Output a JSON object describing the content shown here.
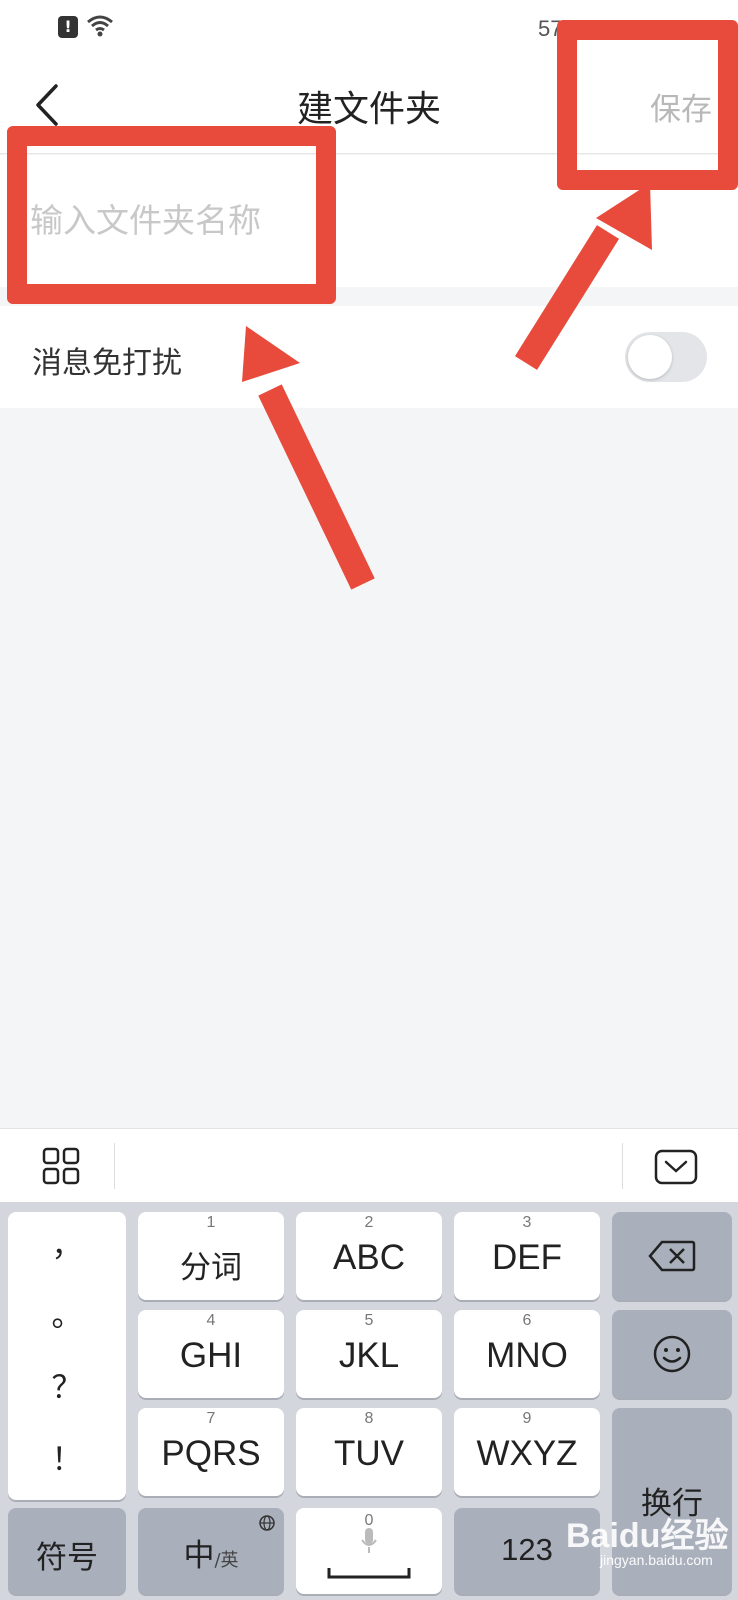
{
  "status_bar": {
    "battery_text": "57",
    "alert_glyph": "!"
  },
  "header": {
    "title": "建文件夹",
    "save_label": "保存"
  },
  "folder_name": {
    "placeholder": "输入文件夹名称",
    "value": ""
  },
  "dnd": {
    "label": "消息免打扰",
    "enabled": false
  },
  "keyboard": {
    "punctuation": [
      "，",
      "。",
      "？",
      "！"
    ],
    "rows": [
      [
        {
          "num": "1",
          "label": "分词"
        },
        {
          "num": "2",
          "label": "ABC"
        },
        {
          "num": "3",
          "label": "DEF"
        }
      ],
      [
        {
          "num": "4",
          "label": "GHI"
        },
        {
          "num": "5",
          "label": "JKL"
        },
        {
          "num": "6",
          "label": "MNO"
        }
      ],
      [
        {
          "num": "7",
          "label": "PQRS"
        },
        {
          "num": "8",
          "label": "TUV"
        },
        {
          "num": "9",
          "label": "WXYZ"
        }
      ]
    ],
    "symbol_label": "符号",
    "lang_main": "中",
    "lang_sub": "/英",
    "space_num": "0",
    "num_label": "123",
    "enter_label": "换行"
  },
  "watermark": {
    "text": "Baidu经验",
    "sub": "jingyan.baidu.com"
  },
  "colors": {
    "annotation": "#e84a3c",
    "background": "#f4f5f7"
  },
  "icons": [
    "back-icon",
    "wifi-icon",
    "alert-icon",
    "grid-icon",
    "keyboard-hide-icon",
    "backspace-icon",
    "emoji-icon",
    "microphone-icon",
    "globe-icon"
  ]
}
